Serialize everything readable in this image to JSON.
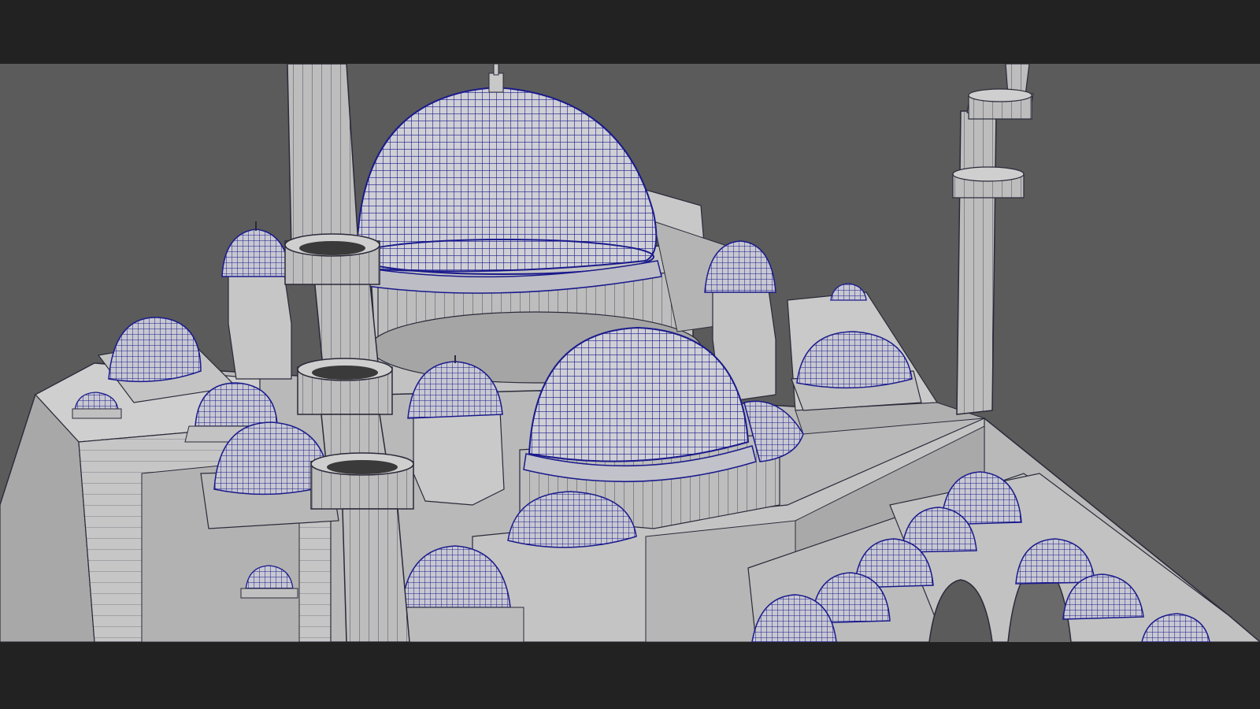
{
  "viewport": {
    "background_color": "#5b5b5b",
    "wire_color": "#1a1a8c",
    "edge_color": "#2a2a3a",
    "surface_light": "#d4d4d4",
    "surface_mid": "#b8b8b8",
    "surface_dark": "#9a9a9a",
    "letterbox_color": "#222222"
  }
}
